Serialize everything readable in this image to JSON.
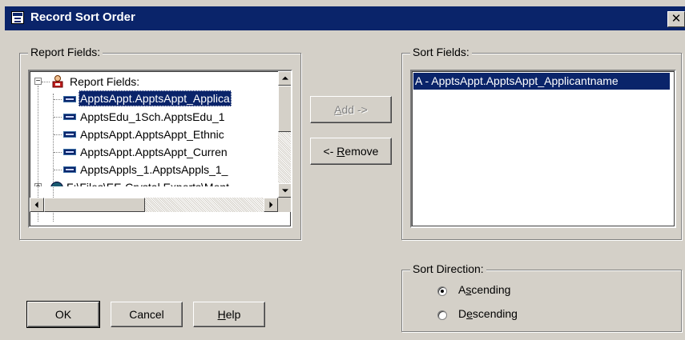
{
  "window": {
    "title": "Record Sort Order",
    "close_glyph": "✕"
  },
  "report_fields": {
    "group_label": "Report Fields:",
    "tree": {
      "root_label": "Report Fields:",
      "root_expander": "−",
      "items": [
        {
          "label": "ApptsAppt.ApptsAppt_Applica",
          "selected": true
        },
        {
          "label": "ApptsEdu_1Sch.ApptsEdu_1",
          "selected": false
        },
        {
          "label": "ApptsAppt.ApptsAppt_Ethnic",
          "selected": false
        },
        {
          "label": "ApptsAppt.ApptsAppt_Curren",
          "selected": false
        },
        {
          "label": "ApptsAppls_1.ApptsAppls_1_",
          "selected": false
        }
      ],
      "partial_item": "F:\\Files\\EE-Crystal Exports\\Mont",
      "partial_expander": "+"
    }
  },
  "buttons": {
    "add": {
      "mnemonic": "A",
      "rest": "dd ->",
      "enabled": false
    },
    "remove": {
      "before": "<- ",
      "mnemonic": "R",
      "rest": "emove",
      "enabled": true
    },
    "ok": "OK",
    "cancel": "Cancel",
    "help": {
      "mnemonic": "H",
      "rest": "elp"
    }
  },
  "sort_fields": {
    "group_label": "Sort Fields:",
    "items": [
      {
        "label": "A - ApptsAppt.ApptsAppt_Applicantname",
        "selected": true
      }
    ]
  },
  "sort_direction": {
    "group_label": "Sort Direction:",
    "options": [
      {
        "pre": "A",
        "mnemonic": "s",
        "rest": "cending",
        "checked": true
      },
      {
        "pre": "D",
        "mnemonic": "e",
        "rest": "scending",
        "checked": false
      }
    ]
  },
  "icons": {
    "title": "dialog-icon",
    "root": "report-icon",
    "field": "field-icon",
    "partial": "database-icon"
  },
  "colors": {
    "titlebar": "#0a246a",
    "face": "#d4d0c8",
    "selection": "#0a246a"
  }
}
